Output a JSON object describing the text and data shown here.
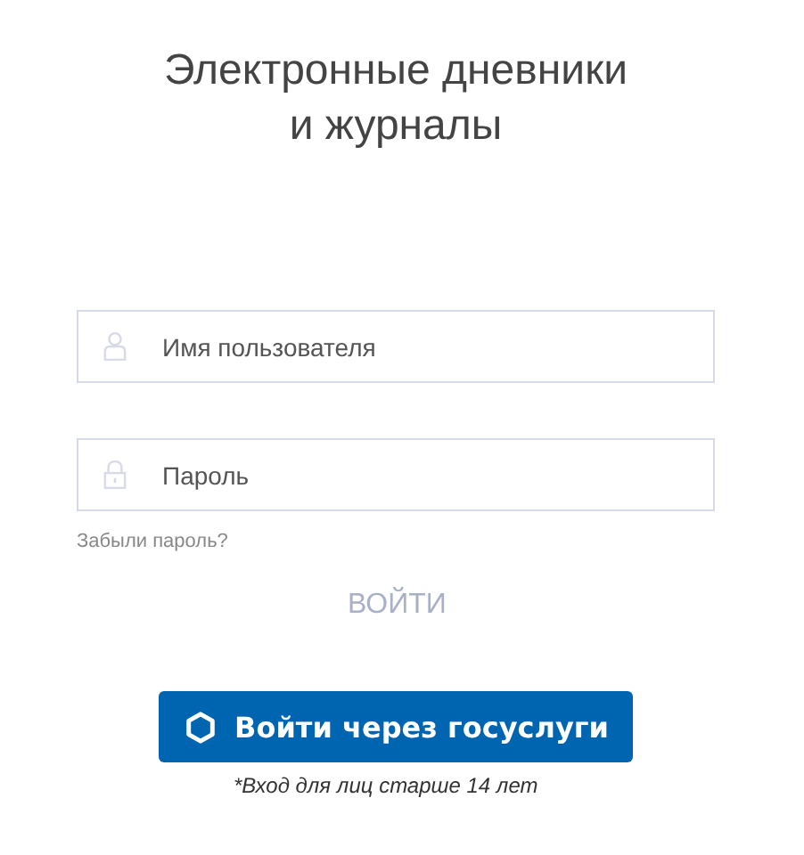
{
  "title_lines": [
    "Электронные дневники",
    "и журналы"
  ],
  "fields": [
    {
      "kind": "user",
      "placeholder": "Имя пользователя"
    },
    {
      "kind": "password",
      "placeholder": "Пароль"
    }
  ],
  "forgot_link": "Забыли пароль?",
  "login_button": {
    "label": "ВОЙТИ",
    "disabled": true
  },
  "gosuslugi_button": {
    "label": "Войти через госуслуги"
  },
  "age_note": "*Вход для лиц старше 14 лет"
}
